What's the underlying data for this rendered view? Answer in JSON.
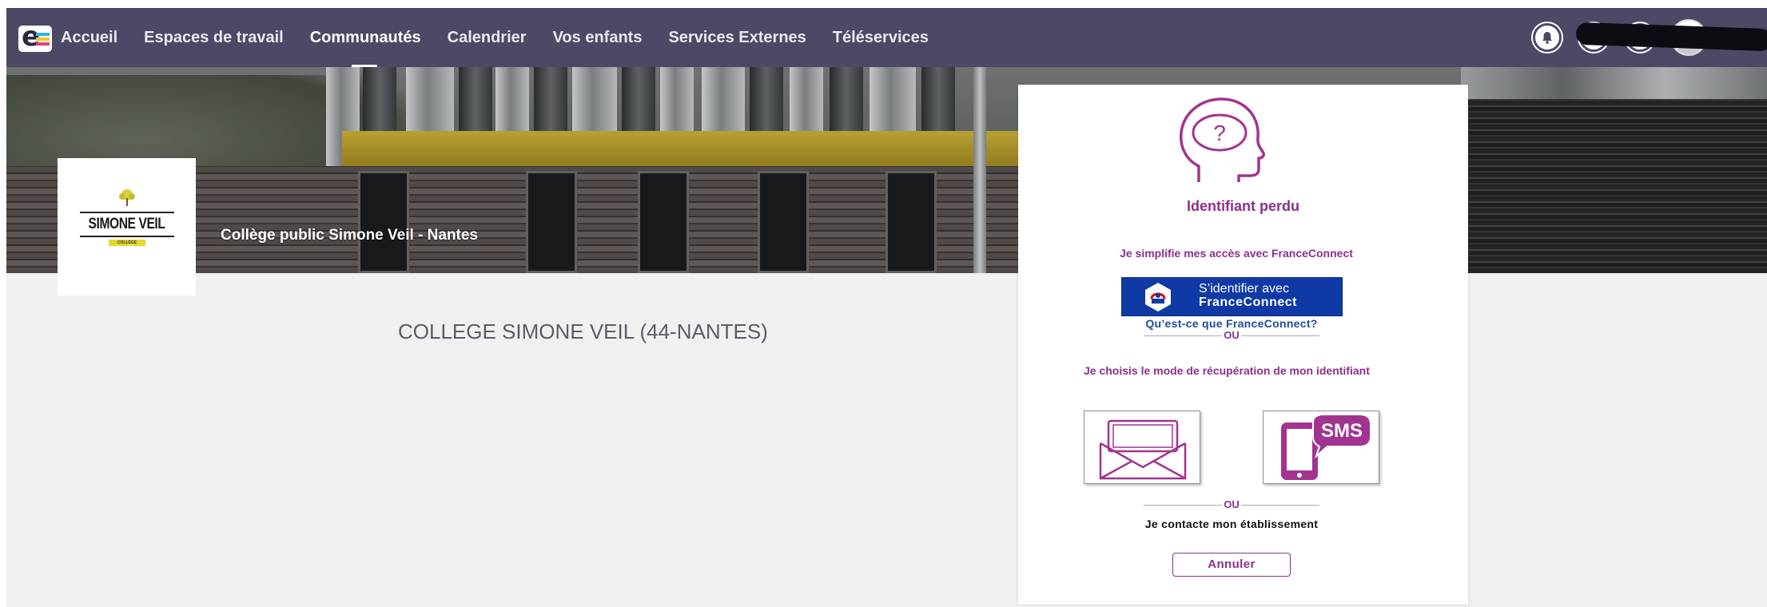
{
  "nav": {
    "brand_icon": "ent-logo-icon",
    "items": [
      {
        "label": "Accueil"
      },
      {
        "label": "Espaces de travail"
      },
      {
        "label": "Communautés",
        "active": true
      },
      {
        "label": "Calendrier"
      },
      {
        "label": "Vos enfants"
      },
      {
        "label": "Services Externes"
      },
      {
        "label": "Téléservices"
      }
    ],
    "right_icons": [
      "bell-icon",
      "mail-icon",
      "chat-icon",
      "avatar"
    ]
  },
  "school": {
    "logo_text": "SIMONE VEIL",
    "logo_tag": "COLLÈGE",
    "subtitle": "Collège public Simone Veil - Nantes",
    "title": "COLLEGE SIMONE VEIL (44-NANTES)"
  },
  "recovery": {
    "title": "Identifiant perdu",
    "fc_intro": "Je simplifie mes accès avec FranceConnect",
    "fc_button_line1": "S’identifier avec",
    "fc_button_line2": "FranceConnect",
    "fc_link": "Qu’est-ce que FranceConnect?",
    "or_label": "OU",
    "choose_label": "Je choisis le mode de récupération de mon identifiant",
    "option_mail_icon": "envelope-icon",
    "option_sms_icon": "sms-phone-icon",
    "sms_text": "SMS",
    "contact_label": "Je contacte mon établissement",
    "cancel_label": "Annuler"
  },
  "colors": {
    "navbar": "#4b4966",
    "accent_purple": "#8c2f8c",
    "franceconnect_blue": "#0f3aa5",
    "background": "#f1f0f1"
  }
}
